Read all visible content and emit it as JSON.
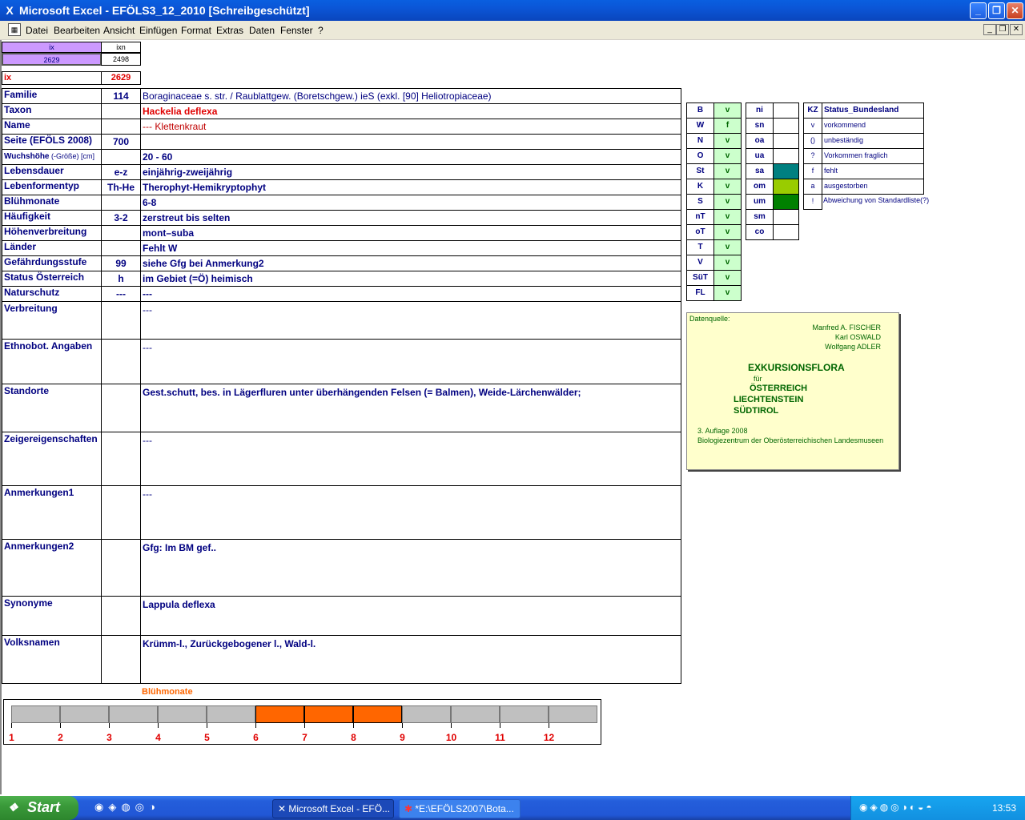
{
  "window": {
    "title": "Microsoft Excel - EFÖLS3_12_2010  [Schreibgeschützt]",
    "minimize": "_",
    "maximize": "❐",
    "close": "✕"
  },
  "menu": [
    "Datei",
    "Bearbeiten",
    "Ansicht",
    "Einfügen",
    "Format",
    "Extras",
    "Daten",
    "Fenster",
    "?"
  ],
  "mdi": {
    "minimize": "_",
    "restore": "❐",
    "close": "✕"
  },
  "index_box": {
    "h1": "ix",
    "h2": "ixn",
    "v1": "2629",
    "v2": "2498",
    "ix_label": "ix",
    "ix_value": "2629"
  },
  "rows": [
    {
      "label": "Familie",
      "code": "114",
      "value": "Boraginaceae s. str.  /  Raublattgew. (Boretschgew.) ieS (exkl. [90] Heliotropiaceae)"
    },
    {
      "label": "Taxon",
      "code": "",
      "value": "Hackelia deflexa"
    },
    {
      "label": "Name",
      "code": "",
      "value": "--- Klettenkraut"
    },
    {
      "label": "Seite (EFÖLS 2008)",
      "code": "700",
      "value": ""
    },
    {
      "label": "Wuchshöhe",
      "label_sub": "(-Größe) [cm]",
      "code": "",
      "value": " 20 - 60"
    },
    {
      "label": "Lebensdauer",
      "code": "e-z",
      "value": "einjährig-zweijährig"
    },
    {
      "label": "Lebenformentyp",
      "code": "Th-He",
      "value": "Therophyt-Hemikryptophyt"
    },
    {
      "label": "Blühmonate",
      "code": "",
      "value": " 6-8"
    },
    {
      "label": "Häufigkeit",
      "code": "3-2",
      "value": "zerstreut bis selten"
    },
    {
      "label": "Höhenverbreitung",
      "code": "",
      "value": "mont–suba"
    },
    {
      "label": "Länder",
      "code": "",
      "value": "Fehlt W"
    },
    {
      "label": "Gefährdungsstufe",
      "code": "99",
      "value": "siehe Gfg bei Anmerkung2"
    },
    {
      "label": "Status Österreich",
      "code": "h",
      "value": "im Gebiet (=Ö) heimisch"
    },
    {
      "label": "Naturschutz",
      "code": "---",
      "value": " ---"
    }
  ],
  "big_rows": [
    {
      "label": "Verbreitung",
      "value": " ---"
    },
    {
      "label": "Ethnobot. Angaben",
      "value": "---"
    },
    {
      "label": "Standorte",
      "value": "Gest.schutt, bes. in Lägerfluren unter überhängenden Felsen (= Balmen), Weide-Lärchenwälder;"
    },
    {
      "label": "Zeigereigenschaften",
      "value": "---"
    },
    {
      "label": "Anmerkungen1",
      "value": "---"
    },
    {
      "label": "Anmerkungen2",
      "value": "Gfg: Im BM gef.."
    },
    {
      "label": "Synonyme",
      "value": "Lappula deflexa"
    },
    {
      "label": "Volksnamen",
      "value": "Krümm-l., Zurückgebogener l., Wald-l."
    }
  ],
  "states": [
    {
      "code": "B",
      "status": "v"
    },
    {
      "code": "W",
      "status": "f"
    },
    {
      "code": "N",
      "status": "v"
    },
    {
      "code": "O",
      "status": "v"
    },
    {
      "code": "St",
      "status": "v"
    },
    {
      "code": "K",
      "status": "v"
    },
    {
      "code": "S",
      "status": "v"
    },
    {
      "code": "nT",
      "status": "v"
    },
    {
      "code": "oT",
      "status": "v"
    },
    {
      "code": "T",
      "status": "v"
    },
    {
      "code": "V",
      "status": "v"
    },
    {
      "code": "SüT",
      "status": "v"
    },
    {
      "code": "FL",
      "status": "v"
    }
  ],
  "zones": [
    {
      "code": "ni",
      "color": ""
    },
    {
      "code": "sn",
      "color": ""
    },
    {
      "code": "oa",
      "color": ""
    },
    {
      "code": "ua",
      "color": ""
    },
    {
      "code": "sa",
      "color": "#008080"
    },
    {
      "code": "om",
      "color": "#99cc00"
    },
    {
      "code": "um",
      "color": "#008000"
    },
    {
      "code": "sm",
      "color": ""
    },
    {
      "code": "co",
      "color": ""
    }
  ],
  "legend": {
    "header_code": "KZ",
    "header_label": "Status_Bundesland",
    "items": [
      {
        "code": "v",
        "label": "vorkommend"
      },
      {
        "code": "()",
        "label": "unbeständig"
      },
      {
        "code": "?",
        "label": "Vorkommen fraglich"
      },
      {
        "code": "f",
        "label": "fehlt"
      },
      {
        "code": "a",
        "label": "ausgestorben"
      },
      {
        "code": "!",
        "label": "Abweichung von Standardliste(?)"
      }
    ]
  },
  "source": {
    "heading": "Datenquelle:",
    "authors": [
      "Manfred A. FISCHER",
      "Karl OSWALD",
      "Wolfgang ADLER"
    ],
    "title": "EXKURSIONSFLORA",
    "fuer": "für",
    "countries": [
      "ÖSTERREICH",
      "LIECHTENSTEIN",
      "SÜDTIROL"
    ],
    "edition": "3. Auflage 2008",
    "publisher": "Biologiezentrum der Oberösterreichischen Landesmuseen"
  },
  "bloom": {
    "title": "Blühmonate",
    "months": [
      "1",
      "2",
      "3",
      "4",
      "5",
      "6",
      "7",
      "8",
      "9",
      "10",
      "11",
      "12"
    ],
    "active": [
      6,
      7,
      8
    ],
    "active_color": "#ff6600",
    "inactive_color": "#c0c0c0"
  },
  "taskbar": {
    "start": "Start",
    "tasks": [
      "Microsoft Excel - EFÖ...",
      "*E:\\EFÖLS2007\\Bota..."
    ],
    "clock": "13:53"
  }
}
